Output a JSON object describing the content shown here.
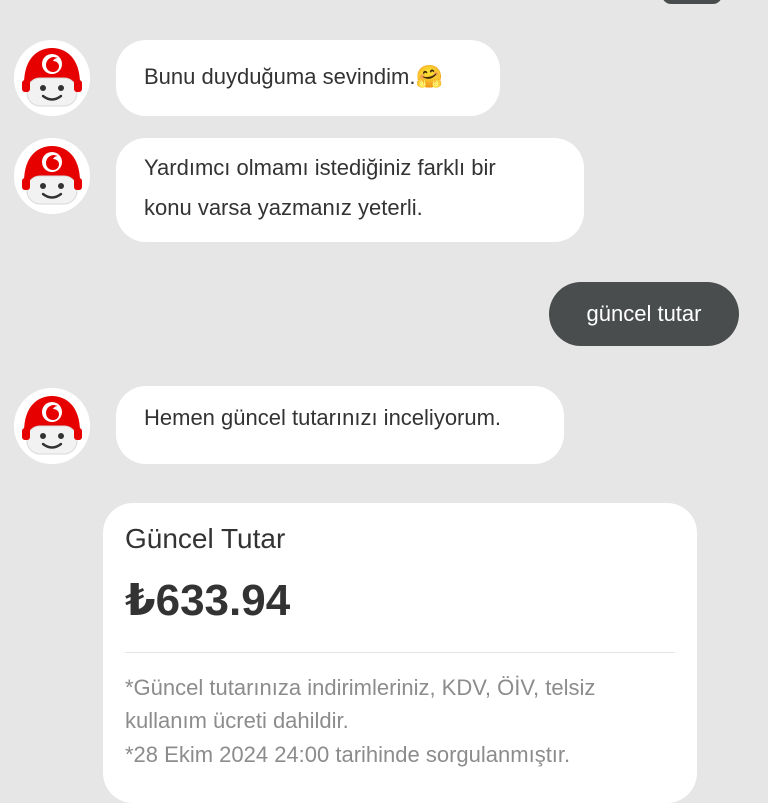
{
  "colors": {
    "background": "#e6e6e6",
    "bot_bubble": "#ffffff",
    "user_bubble": "#4a4d4e",
    "avatar_helmet": "#e60000",
    "muted_text": "#8c8c8c"
  },
  "avatar_icon": "vodafone-tobi-avatar-icon",
  "messages": [
    {
      "sender": "bot",
      "text": "Bunu duyduğuma sevindim.🤗"
    },
    {
      "sender": "bot",
      "lines": [
        "Yardımcı olmamı istediğiniz farklı bir",
        "konu varsa yazmanız yeterli."
      ]
    },
    {
      "sender": "user",
      "text": "güncel tutar"
    },
    {
      "sender": "bot",
      "text": "Hemen güncel tutarınızı inceliyorum."
    }
  ],
  "bill_card": {
    "title": "Güncel Tutar",
    "amount": "₺633.94",
    "note_lines": [
      "*Güncel tutarınıza indirimleriniz, KDV, ÖİV, telsiz",
      "kullanım ücreti dahildir.",
      "*28 Ekim 2024 24:00 tarihinde sorgulanmıştır."
    ]
  }
}
